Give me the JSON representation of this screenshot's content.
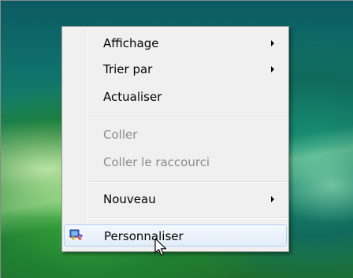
{
  "context_menu": {
    "items": [
      {
        "label": "Affichage",
        "submenu": true,
        "enabled": true
      },
      {
        "label": "Trier par",
        "submenu": true,
        "enabled": true
      },
      {
        "label": "Actualiser",
        "submenu": false,
        "enabled": true
      },
      {
        "label": "Coller",
        "submenu": false,
        "enabled": false
      },
      {
        "label": "Coller le raccourci",
        "submenu": false,
        "enabled": false
      },
      {
        "label": "Nouveau",
        "submenu": true,
        "enabled": true
      },
      {
        "label": "Personnaliser",
        "submenu": false,
        "enabled": true,
        "icon": "personalize-icon",
        "highlighted": true
      }
    ]
  },
  "colors": {
    "menu_background": "#f0f0f0",
    "highlight_border": "#aecff7",
    "disabled_text": "#8a8a8a"
  }
}
